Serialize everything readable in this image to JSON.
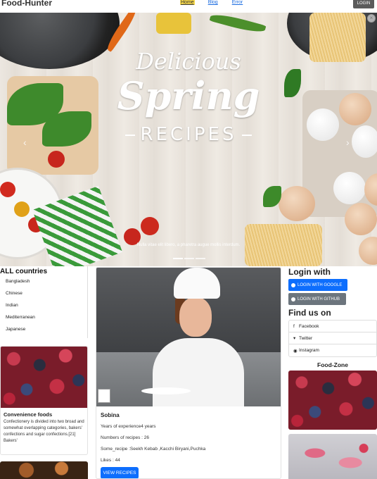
{
  "nav": {
    "brand": "Food-Hunter",
    "links": [
      "Home",
      "Blog",
      "Error"
    ],
    "login": "LOGIN"
  },
  "hero": {
    "line1": "Delicious",
    "line2": "Spring",
    "line3": "RECIPES",
    "caption": "Nulla vitae elit libero, a pharetra augue mollis interdum.",
    "prev": "‹",
    "next": "›",
    "close": "×"
  },
  "countries": {
    "title": "ALL countries",
    "items": [
      "Bangladesh",
      "Chinese",
      "Indian",
      "Mediterranean",
      "Japanese"
    ]
  },
  "convenience": {
    "title": "Convenience foods",
    "text": "Confectionery is divided into two broad and somewhat overlapping categories, bakers' confections and sugar confections.[21] Bakers'"
  },
  "chef": {
    "name": "Sobina",
    "experience": "Years of experience4 years",
    "recipes": "Numbers of recipes : 26",
    "some_recipe": "Some_recipe :Seekh Kebab ,Kacchi Biryani,Puchka",
    "likes": "Likes : 44",
    "view_button": "VIEW RECIPES"
  },
  "sidebar": {
    "login_with": "Login with",
    "google": "LOGIN WITH GOOGLE",
    "github": "LOGIN WITH GITHUB",
    "find_us": "Find us on",
    "social": [
      "Facebook",
      "Twitter",
      "Instagram"
    ],
    "food_zone": "Food-Zone"
  },
  "icons": {
    "google": "google-icon",
    "github": "github-icon",
    "facebook": "facebook-icon",
    "twitter": "twitter-icon",
    "instagram": "instagram-icon"
  },
  "colors": {
    "primary": "#0d6efd",
    "secondary": "#6c757d",
    "active_nav": "#f6d84a"
  }
}
